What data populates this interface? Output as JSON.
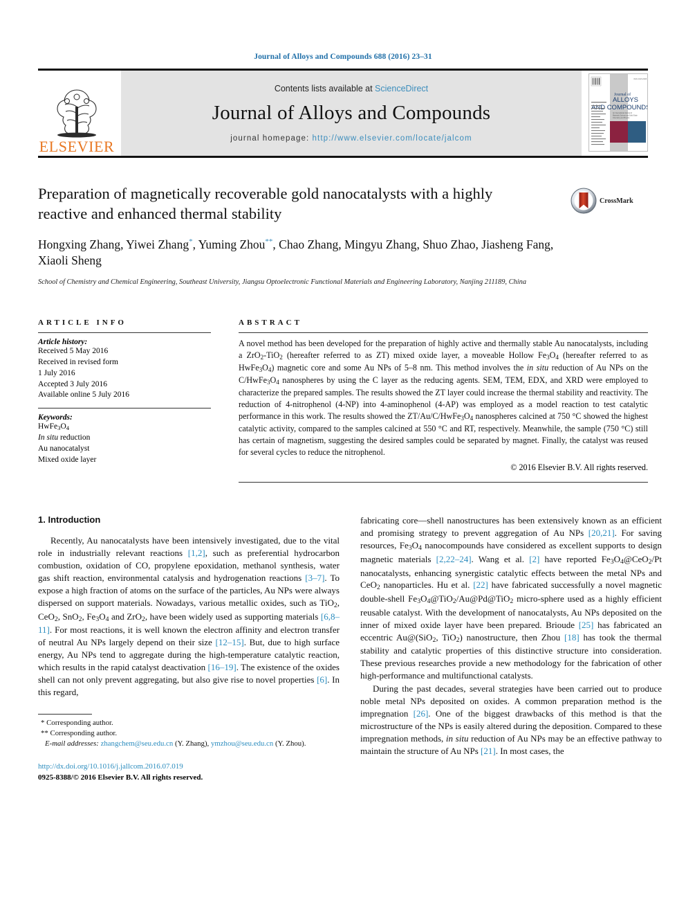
{
  "running_head": "Journal of Alloys and Compounds 688 (2016) 23–31",
  "masthead": {
    "contents_prefix": "Contents lists available at ",
    "contents_link": "ScienceDirect",
    "journal_name": "Journal of Alloys and Compounds",
    "homepage_prefix": "journal homepage: ",
    "homepage_url": "http://www.elsevier.com/locate/jalcom",
    "publisher": "ELSEVIER",
    "cover_title_small": "Journal of",
    "cover_title_main": "ALLOYS",
    "cover_title_main2": "AND COMPOUNDS"
  },
  "article": {
    "title": "Preparation of magnetically recoverable gold nanocatalysts with a highly reactive and enhanced thermal stability",
    "authors": "Hongxing Zhang, Yiwei Zhang*, Yuming Zhou**, Chao Zhang, Mingyu Zhang, Shuo Zhao, Jiasheng Fang, Xiaoli Sheng",
    "affiliation": "School of Chemistry and Chemical Engineering, Southeast University, Jiangsu Optoelectronic Functional Materials and Engineering Laboratory, Nanjing 211189, China",
    "crossmark_label": "CrossMark"
  },
  "article_info": {
    "heading": "ARTICLE INFO",
    "history_label": "Article history:",
    "history": [
      "Received 5 May 2016",
      "Received in revised form",
      "1 July 2016",
      "Accepted 3 July 2016",
      "Available online 5 July 2016"
    ],
    "keywords_label": "Keywords:",
    "keywords": [
      "HwFe3O4",
      "In situ reduction",
      "Au nanocatalyst",
      "Mixed oxide layer"
    ]
  },
  "abstract": {
    "heading": "ABSTRACT",
    "text": "A novel method has been developed for the preparation of highly active and thermally stable Au nanocatalysts, including a ZrO2-TiO2 (hereafter referred to as ZT) mixed oxide layer, a moveable Hollow Fe3O4 (hereafter referred to as HwFe3O4) magnetic core and some Au NPs of 5–8 nm. This method involves the in situ reduction of Au NPs on the C/HwFe3O4 nanospheres by using the C layer as the reducing agents. SEM, TEM, EDX, and XRD were employed to characterize the prepared samples. The results showed the ZT layer could increase the thermal stability and reactivity. The reduction of 4-nitrophenol (4-NP) into 4-aminophenol (4-AP) was employed as a model reaction to test catalytic performance in this work. The results showed the ZT/Au/C/HwFe3O4 nanospheres calcined at 750 °C showed the highest catalytic activity, compared to the samples calcined at 550 °C and RT, respectively. Meanwhile, the sample (750 °C) still has certain of magnetism, suggesting the desired samples could be separated by magnet. Finally, the catalyst was reused for several cycles to reduce the nitrophenol.",
    "copyright": "© 2016 Elsevier B.V. All rights reserved."
  },
  "introduction": {
    "heading": "1. Introduction",
    "para1": "Recently, Au nanocatalysts have been intensively investigated, due to the vital role in industrially relevant reactions [1,2], such as preferential hydrocarbon combustion, oxidation of CO, propylene epoxidation, methanol synthesis, water gas shift reaction, environmental catalysis and hydrogenation reactions [3–7]. To expose a high fraction of atoms on the surface of the particles, Au NPs were always dispersed on support materials. Nowadays, various metallic oxides, such as TiO2, CeO2, SnO2, Fe3O4 and ZrO2, have been widely used as supporting materials [6,8–11]. For most reactions, it is well known the electron affinity and electron transfer of neutral Au NPs largely depend on their size [12–15]. But, due to high surface energy, Au NPs tend to aggregate during the high-temperature catalytic reaction, which results in the rapid catalyst deactivation [16–19]. The existence of the oxides shell can not only prevent aggregating, but also give rise to novel properties [6]. In this regard,",
    "para2": "fabricating core—shell nanostructures has been extensively known as an efficient and promising strategy to prevent aggregation of Au NPs [20,21]. For saving resources, Fe3O4 nanocompounds have considered as excellent supports to design magnetic materials [2,22–24]. Wang et al. [2] have reported Fe3O4@CeO2/Pt nanocatalysts, enhancing synergistic catalytic effects between the metal NPs and CeO2 nanoparticles. Hu et al. [22] have fabricated successfully a novel magnetic double-shell Fe3O4@TiO2/Au@Pd@TiO2 micro-sphere used as a highly efficient reusable catalyst. With the development of nanocatalysts, Au NPs deposited on the inner of mixed oxide layer have been prepared. Brioude [25] has fabricated an eccentric Au@(SiO2, TiO2) nanostructure, then Zhou [18] has took the thermal stability and catalytic properties of this distinctive structure into consideration. These previous researches provide a new methodology for the fabrication of other high-performance and multifunctional catalysts.",
    "para3": "During the past decades, several strategies have been carried out to produce noble metal NPs deposited on oxides. A common preparation method is the impregnation [26]. One of the biggest drawbacks of this method is that the microstructure of the NPs is easily altered during the deposition. Compared to these impregnation methods, in situ reduction of Au NPs may be an effective pathway to maintain the structure of Au NPs [21]. In most cases, the"
  },
  "footnotes": {
    "corresponding1": "Corresponding author.",
    "corresponding2": "Corresponding author.",
    "email_label": "E-mail addresses:",
    "email1": "zhangchem@seu.edu.cn",
    "email1_name": "(Y. Zhang)",
    "email2": "ymzhou@seu.edu.cn",
    "email2_name": "(Y. Zhou).",
    "doi": "http://dx.doi.org/10.1016/j.jallcom.2016.07.019",
    "issn_line": "0925-8388/© 2016 Elsevier B.V. All rights reserved."
  },
  "colors": {
    "link": "#2b8cbe",
    "elsevier_orange": "#E87722",
    "header_blue": "#1f6fa8",
    "band_gray": "#e3e3e3"
  }
}
